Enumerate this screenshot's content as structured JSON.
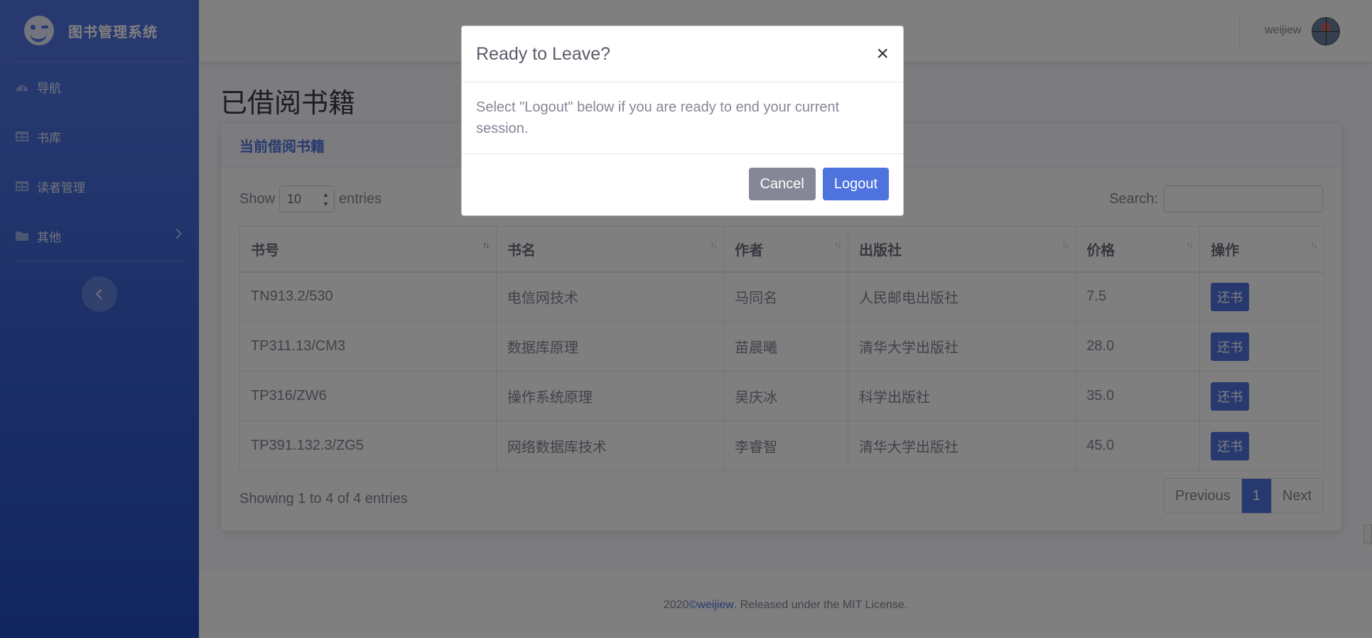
{
  "brand": {
    "title": "图书管理系统"
  },
  "sidebar": {
    "items": [
      {
        "label": "导航"
      },
      {
        "label": "书库"
      },
      {
        "label": "读者管理"
      },
      {
        "label": "其他"
      }
    ]
  },
  "topbar": {
    "user": "weijiew"
  },
  "page": {
    "title": "已借阅书籍"
  },
  "card": {
    "header": "当前借阅书籍"
  },
  "datatable": {
    "show_label": "Show",
    "entries_label": "entries",
    "page_length": "10",
    "search_label": "Search:",
    "columns": [
      "书号",
      "书名",
      "作者",
      "出版社",
      "价格",
      "操作"
    ],
    "rows": [
      {
        "id": "TN913.2/530",
        "name": "电信网技术",
        "author": "马同名",
        "publisher": "人民邮电出版社",
        "price": "7.5",
        "action": "还书"
      },
      {
        "id": "TP311.13/CM3",
        "name": "数据库原理",
        "author": "苗晨曦",
        "publisher": "清华大学出版社",
        "price": "28.0",
        "action": "还书"
      },
      {
        "id": "TP316/ZW6",
        "name": "操作系统原理",
        "author": "吴庆冰",
        "publisher": "科学出版社",
        "price": "35.0",
        "action": "还书"
      },
      {
        "id": "TP391.132.3/ZG5",
        "name": "网络数据库技术",
        "author": "李睿智",
        "publisher": "清华大学出版社",
        "price": "45.0",
        "action": "还书"
      }
    ],
    "info": "Showing 1 to 4 of 4 entries",
    "pagination": {
      "previous": "Previous",
      "current": "1",
      "next": "Next"
    }
  },
  "footer": {
    "prefix": "2020 ",
    "link": "©weijiew",
    "suffix": ". Released under the MIT License."
  },
  "modal": {
    "title": "Ready to Leave?",
    "close": "×",
    "body": "Select \"Logout\" below if you are ready to end your current session.",
    "cancel": "Cancel",
    "logout": "Logout"
  },
  "colors": {
    "primary": "#4e73df",
    "secondary": "#858796",
    "sidebar_gradient_end": "#224abe"
  }
}
